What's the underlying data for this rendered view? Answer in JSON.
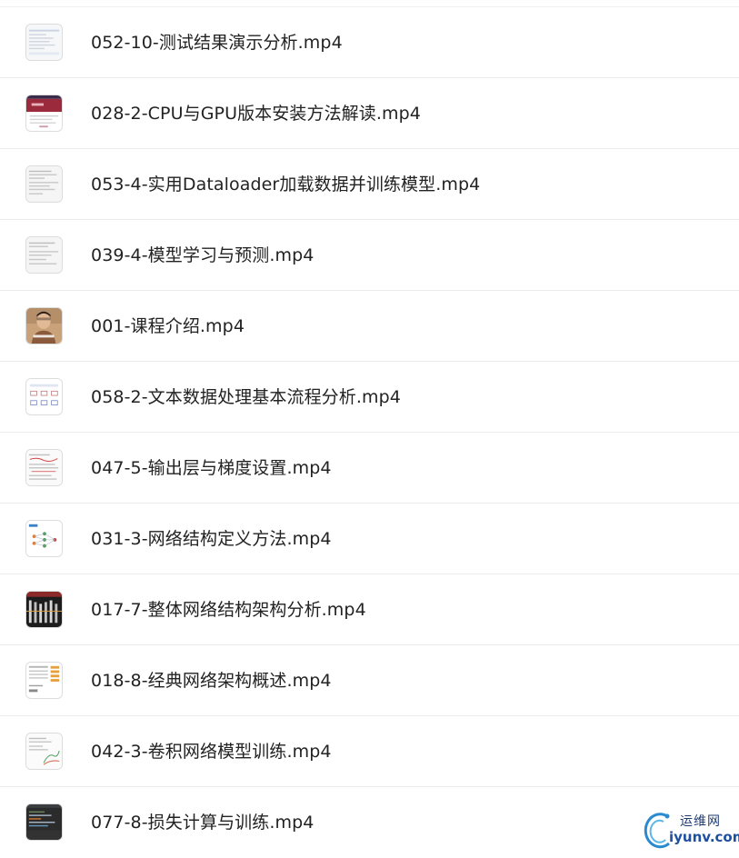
{
  "files": [
    {
      "name": "052-10-测试结果演示分析.mp4",
      "thumb": "screen-doc-thumbnail-icon"
    },
    {
      "name": "028-2-CPU与GPU版本安装方法解读.mp4",
      "thumb": "webpage-red-banner-thumbnail-icon"
    },
    {
      "name": "053-4-实用Dataloader加载数据并训练模型.mp4",
      "thumb": "code-screen-thumbnail-icon"
    },
    {
      "name": "039-4-模型学习与预测.mp4",
      "thumb": "code-screen-thumbnail-icon"
    },
    {
      "name": "001-课程介绍.mp4",
      "thumb": "presenter-video-thumbnail-icon"
    },
    {
      "name": "058-2-文本数据处理基本流程分析.mp4",
      "thumb": "diagram-slide-thumbnail-icon"
    },
    {
      "name": "047-5-输出层与梯度设置.mp4",
      "thumb": "annotated-code-thumbnail-icon"
    },
    {
      "name": "031-3-网络结构定义方法.mp4",
      "thumb": "network-diagram-thumbnail-icon"
    },
    {
      "name": "017-7-整体网络结构架构分析.mp4",
      "thumb": "dark-architecture-thumbnail-icon"
    },
    {
      "name": "018-8-经典网络架构概述.mp4",
      "thumb": "table-slide-thumbnail-icon"
    },
    {
      "name": "042-3-卷积网络模型训练.mp4",
      "thumb": "notebook-plot-thumbnail-icon"
    },
    {
      "name": "077-8-损失计算与训练.mp4",
      "thumb": "dark-ide-thumbnail-icon"
    }
  ],
  "watermark": {
    "cn": "运维网",
    "en": "iyunv.com"
  },
  "colors": {
    "text": "#222222",
    "divider": "#ececec",
    "watermark": "#1e4fa0"
  }
}
